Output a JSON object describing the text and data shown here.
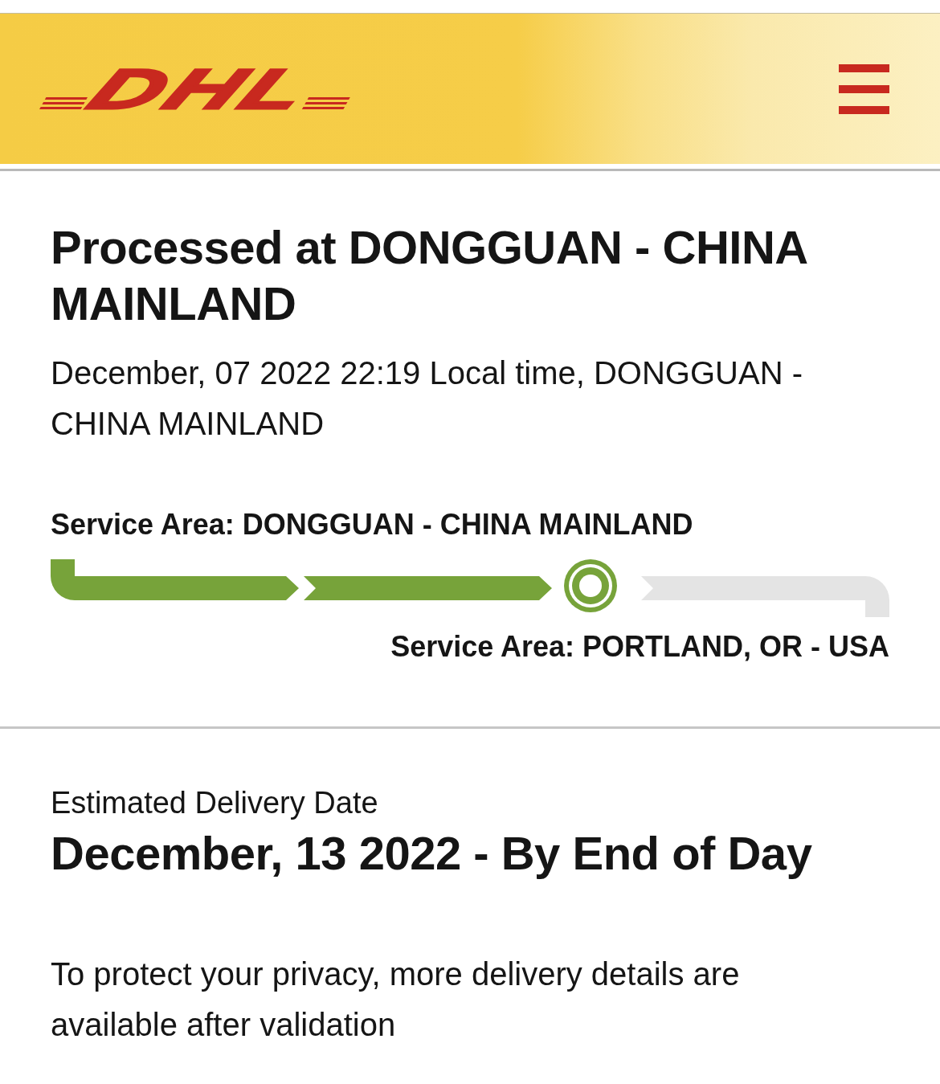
{
  "header": {
    "logo": "DHL"
  },
  "status": {
    "title": "Processed at DONGGUAN - CHINA MAINLAND",
    "timestamp": "December, 07 2022 22:19 Local time, DONGGUAN - CHINA MAINLAND"
  },
  "tracker": {
    "origin": "Service Area: DONGGUAN - CHINA MAINLAND",
    "stages": [
      {
        "kind": "done"
      },
      {
        "kind": "done"
      },
      {
        "kind": "current"
      },
      {
        "kind": "pending"
      }
    ],
    "destination": "Service Area: PORTLAND, OR - USA"
  },
  "delivery": {
    "label": "Estimated Delivery Date",
    "date": "December, 13 2022 - By End of Day",
    "note": "To protect your privacy, more delivery details are available after validation"
  }
}
